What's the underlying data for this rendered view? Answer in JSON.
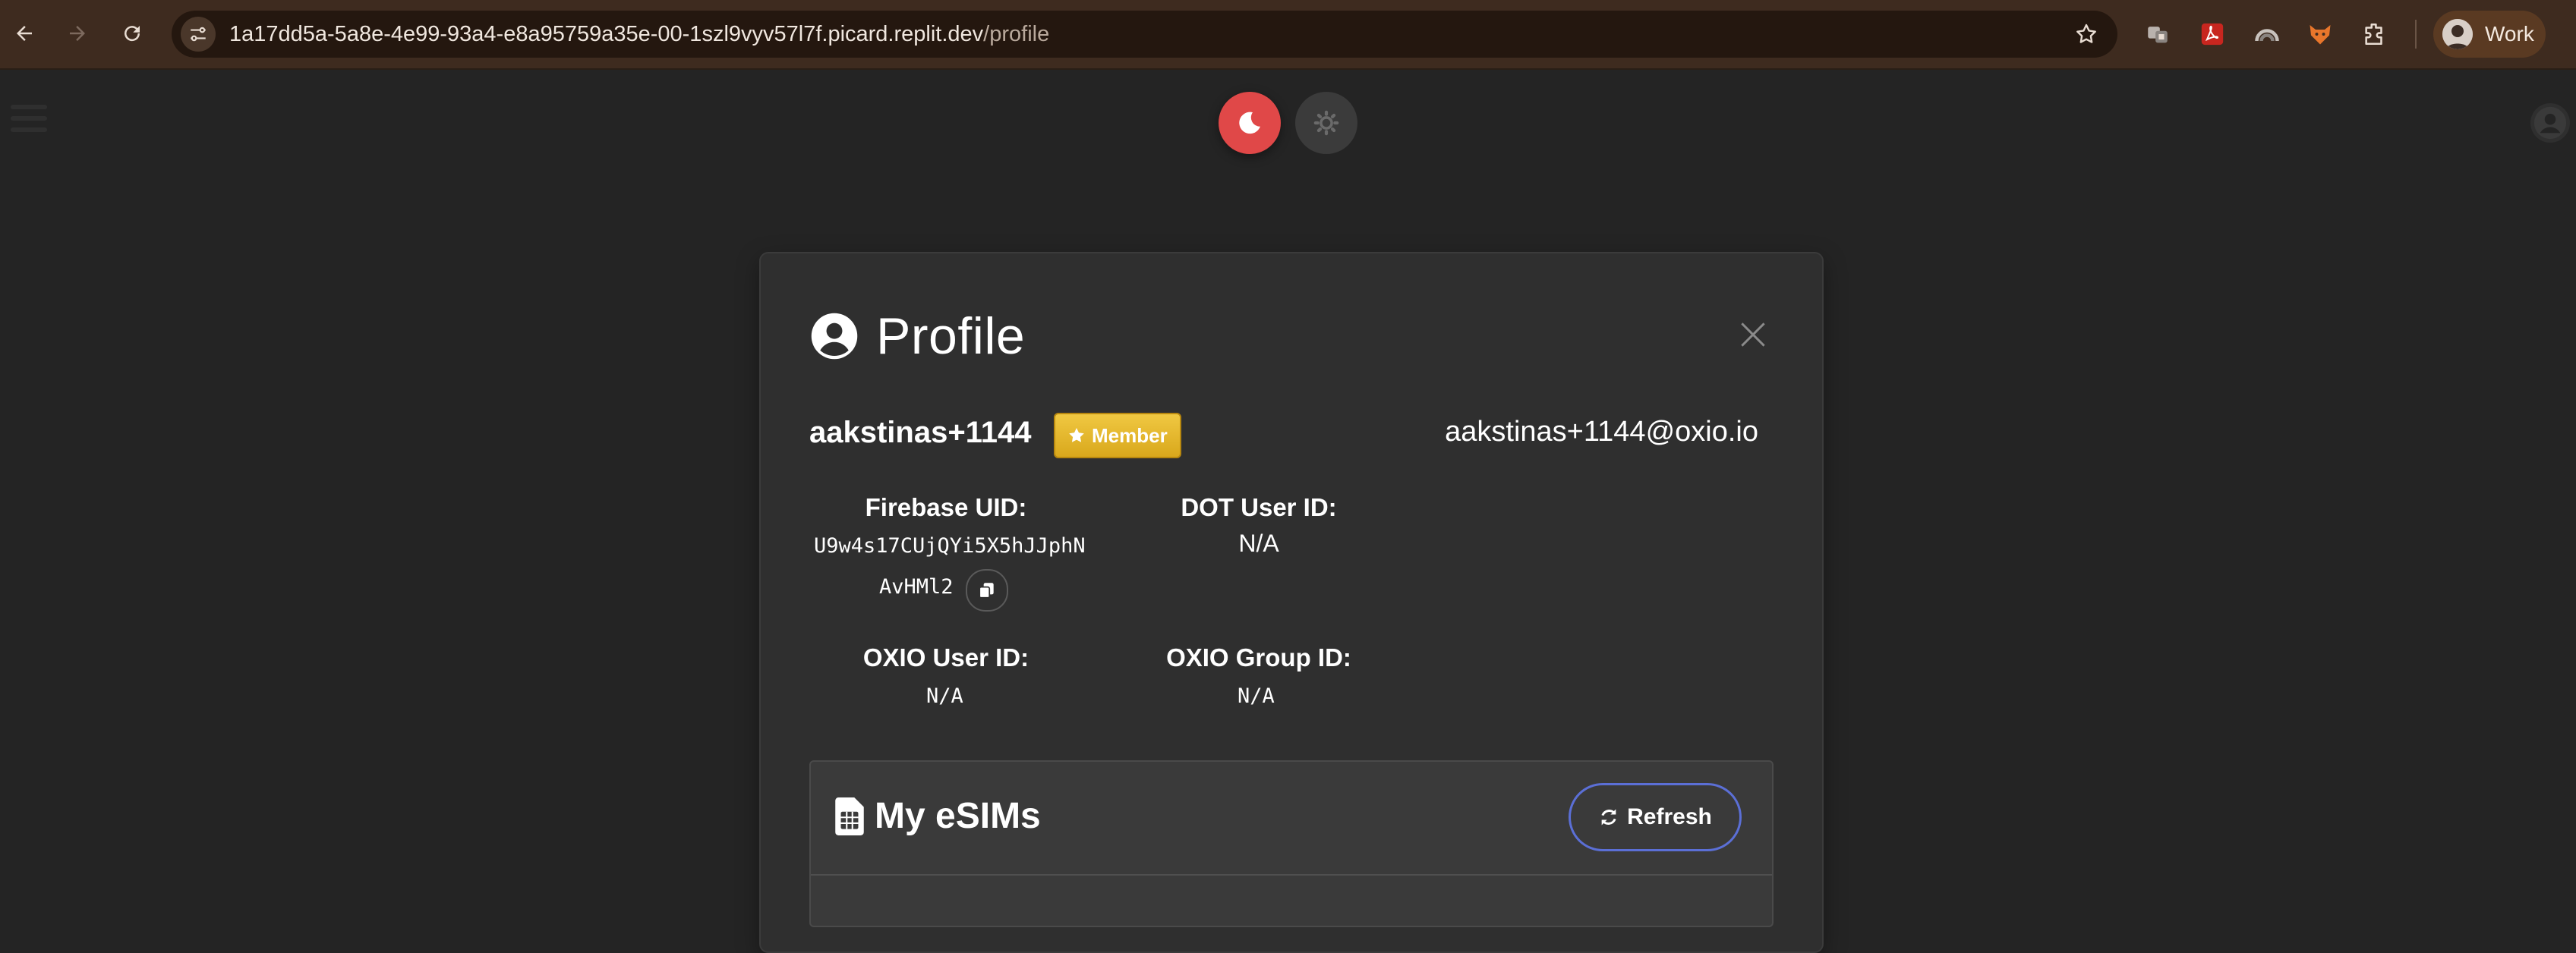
{
  "browser": {
    "url_host": "1a17dd5a-5a8e-4e99-93a4-e8a95759a35e-00-1szl9vyv57l7f.picard.replit.dev",
    "url_path": "/profile",
    "profile_label": "Work",
    "icons": [
      "back-icon",
      "forward-icon",
      "reload-icon",
      "site-info-icon",
      "bookmark-star-icon",
      "extensions-puzzle-icon"
    ]
  },
  "theme": {
    "dark_icon": "moon-icon",
    "light_icon": "gear-sun-icon",
    "accent": "#e04848"
  },
  "profile": {
    "title": "Profile",
    "username": "aakstinas+1144",
    "badge": "Member",
    "email": "aakstinas+1144@oxio.io",
    "fields": {
      "firebase_uid_label": "Firebase UID:",
      "firebase_uid_line1": "U9w4s17CUjQYi5X5hJJphN",
      "firebase_uid_line2": "AvHMl2",
      "dot_user_id_label": "DOT User ID:",
      "dot_user_id_value": "N/A",
      "oxio_user_id_label": "OXIO User ID:",
      "oxio_user_id_value": "N/A",
      "oxio_group_id_label": "OXIO Group ID:",
      "oxio_group_id_value": "N/A"
    }
  },
  "esims": {
    "title": "My eSIMs",
    "refresh_label": "Refresh"
  }
}
